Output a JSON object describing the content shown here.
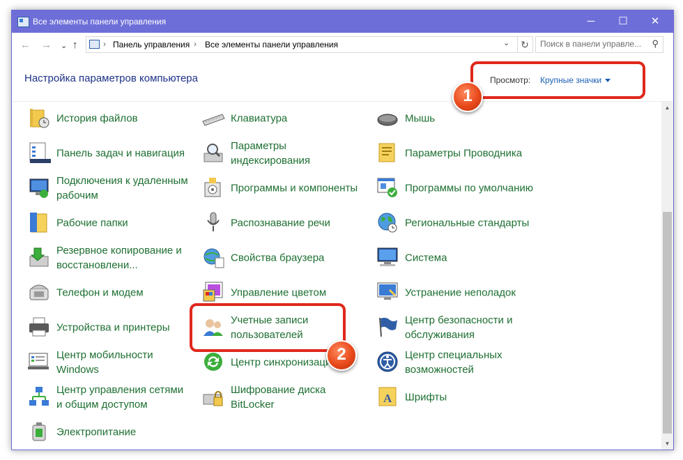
{
  "window": {
    "title": "Все элементы панели управления",
    "controls": {
      "minimize": "─",
      "maximize": "☐",
      "close": "✕"
    }
  },
  "address": {
    "back": "←",
    "forward": "→",
    "up": "↑",
    "separator": "›",
    "crumbs": [
      "Панель управления",
      "Все элементы панели управления"
    ],
    "dropdown": "⌄",
    "refresh": "↻"
  },
  "search": {
    "placeholder": "Поиск в панели управле...",
    "icon": "search-icon",
    "glyph": "⚲"
  },
  "header": {
    "title": "Настройка параметров компьютера",
    "view_label": "Просмотр:",
    "view_value": "Крупные значки"
  },
  "scrollbar": {
    "up": "▲",
    "down": "▼"
  },
  "items": [
    {
      "label": "История файлов",
      "icon": "file-history-icon"
    },
    {
      "label": "Клавиатура",
      "icon": "keyboard-icon"
    },
    {
      "label": "Мышь",
      "icon": "mouse-icon"
    },
    {
      "label": "Панель задач и навигация",
      "icon": "taskbar-icon"
    },
    {
      "label": "Параметры индексирования",
      "icon": "indexing-icon"
    },
    {
      "label": "Параметры Проводника",
      "icon": "explorer-options-icon"
    },
    {
      "label": "Подключения к удаленным рабочим",
      "icon": "remote-connections-icon"
    },
    {
      "label": "Программы и компоненты",
      "icon": "programs-icon"
    },
    {
      "label": "Программы по умолчанию",
      "icon": "default-programs-icon"
    },
    {
      "label": "Рабочие папки",
      "icon": "work-folders-icon"
    },
    {
      "label": "Распознавание речи",
      "icon": "microphone-icon"
    },
    {
      "label": "Региональные стандарты",
      "icon": "region-icon"
    },
    {
      "label": "Резервное копирование и восстановлени...",
      "icon": "backup-icon"
    },
    {
      "label": "Свойства браузера",
      "icon": "browser-icon"
    },
    {
      "label": "Система",
      "icon": "system-icon"
    },
    {
      "label": "Телефон и модем",
      "icon": "phone-icon"
    },
    {
      "label": "Управление цветом",
      "icon": "color-management-icon"
    },
    {
      "label": "Устранение неполадок",
      "icon": "troubleshooting-icon"
    },
    {
      "label": "Устройства и принтеры",
      "icon": "printer-icon"
    },
    {
      "label": "Учетные записи пользователей",
      "icon": "user-accounts-icon"
    },
    {
      "label": "Центр безопасности и обслуживания",
      "icon": "flag-icon"
    },
    {
      "label": "Центр мобильности Windows",
      "icon": "mobility-icon"
    },
    {
      "label": "Центр синхронизации",
      "icon": "sync-icon"
    },
    {
      "label": "Центр специальных возможностей",
      "icon": "accessibility-icon"
    },
    {
      "label": "Центр управления сетями и общим доступом",
      "icon": "network-icon"
    },
    {
      "label": "Шифрование диска BitLocker",
      "icon": "bitlocker-icon"
    },
    {
      "label": "Шрифты",
      "icon": "fonts-icon"
    },
    {
      "label": "Электропитание",
      "icon": "power-icon"
    }
  ],
  "annotations": {
    "one": "1",
    "two": "2",
    "color": "#e0281c"
  }
}
